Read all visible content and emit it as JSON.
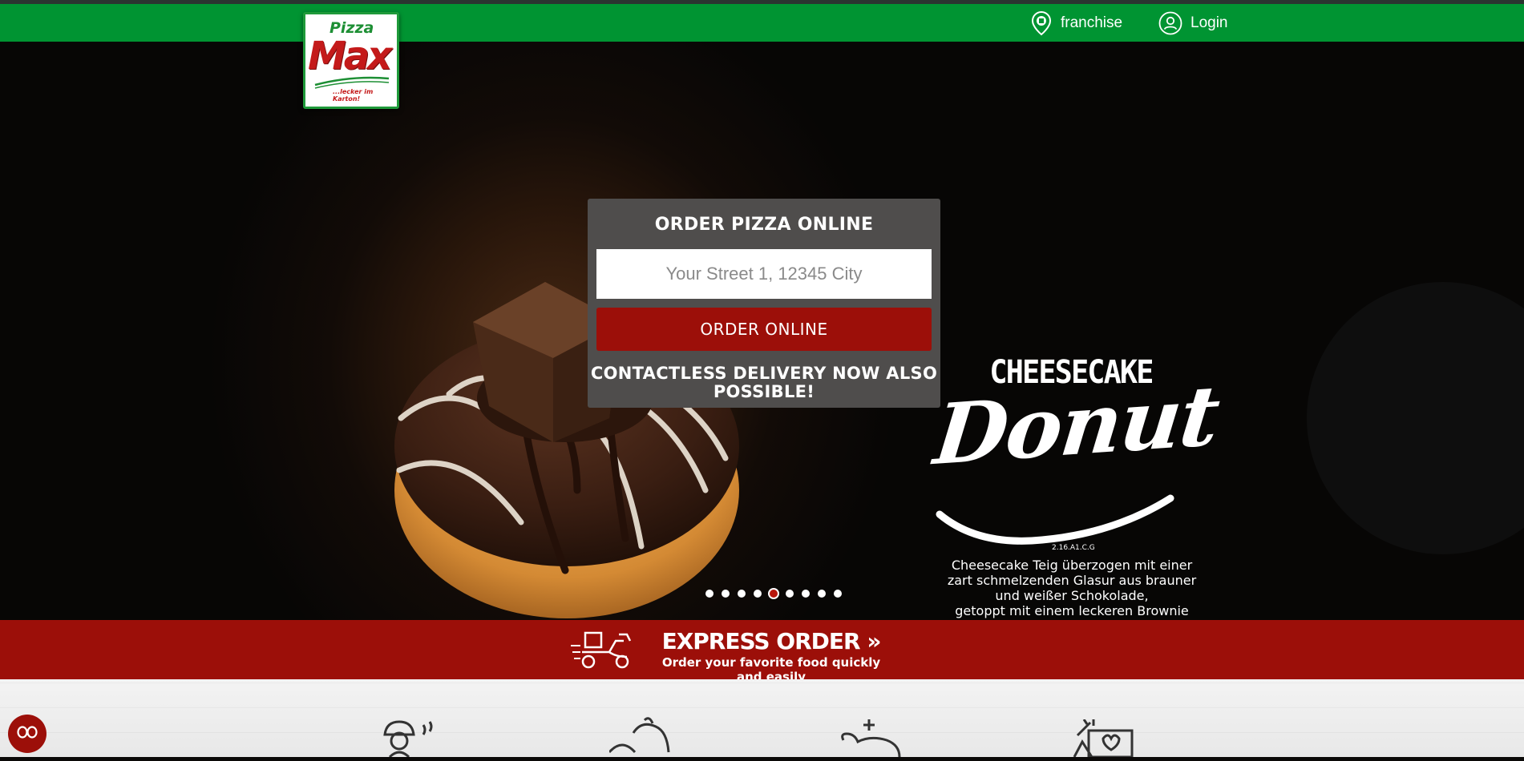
{
  "nav": {
    "franchise_label": "franchise",
    "login_label": "Login"
  },
  "logo": {
    "line1": "Pizza",
    "line2": "Max",
    "tagline": "...lecker im Karton!"
  },
  "order_box": {
    "title": "ORDER PIZZA ONLINE",
    "address_placeholder": "Your Street 1, 12345 City",
    "address_value": "",
    "button_label": "ORDER ONLINE",
    "notice": "CONTACTLESS DELIVERY NOW ALSO POSSIBLE!"
  },
  "promo": {
    "heading_top": "CHEESECAKE",
    "heading_main": "Donut",
    "allergen_code": "2.16.A1.C.G",
    "description_lines": [
      "Cheesecake Teig überzogen mit einer",
      "zart schmelzenden Glasur aus brauner",
      "und weißer Schokolade,",
      "getoppt mit einem leckeren Brownie"
    ]
  },
  "carousel": {
    "slide_count": 9,
    "active_index": 5
  },
  "express": {
    "title": "EXPRESS ORDER »",
    "subtitle": "Order your favorite food quickly and easily"
  },
  "colors": {
    "nav_green": "#009432",
    "brand_red": "#9c0f09",
    "order_box_gray": "#4f4d4c"
  },
  "icons": {
    "franchise": "map-pin-icon",
    "login": "user-icon",
    "express": "delivery-scooter-icon",
    "cookie": "cookie-settings-icon",
    "categories": [
      "chef-icon",
      "vegetable-icon",
      "chicken-icon",
      "deals-icon"
    ]
  }
}
